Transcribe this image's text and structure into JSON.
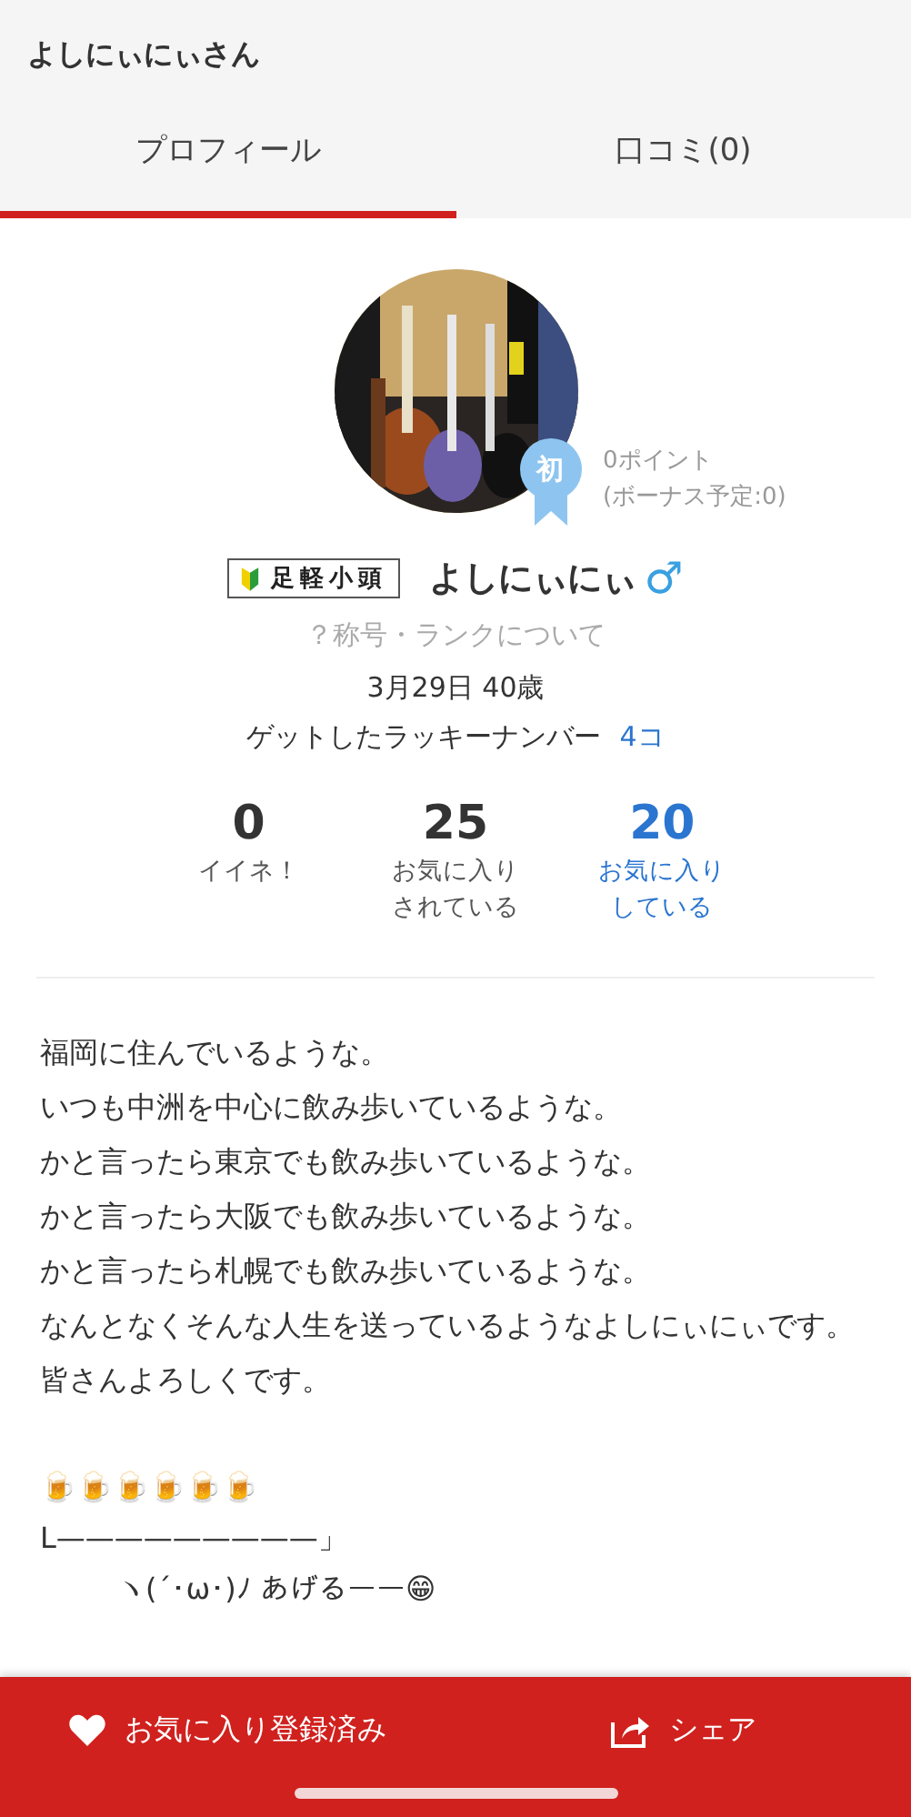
{
  "header": {
    "title": "よしにぃにぃさん"
  },
  "tabs": [
    {
      "label": "プロフィール",
      "selected": true
    },
    {
      "label": "口コミ(0)",
      "selected": false
    }
  ],
  "profile": {
    "badge": "初",
    "points": "0ポイント",
    "bonus": "(ボーナス予定:0)",
    "rank_title": "足軽小頭",
    "name": "よしにぃにぃ",
    "gender": "♂",
    "rank_link": "？称号・ランクについて",
    "birthday": "3月29日 40歳",
    "lucky_label": "ゲットしたラッキーナンバー",
    "lucky_count": "4コ"
  },
  "stats": [
    {
      "value": "0",
      "label": [
        "イイネ！"
      ],
      "kind": "plain"
    },
    {
      "value": "25",
      "label": [
        "お気に入り",
        "されている"
      ],
      "kind": "plain"
    },
    {
      "value": "20",
      "label": [
        "お気に入り",
        "している"
      ],
      "kind": "link"
    }
  ],
  "bio": [
    "福岡に住んでいるような。",
    "いつも中洲を中心に飲み歩いているような。",
    "かと言ったら東京でも飲み歩いているような。",
    "かと言ったら大阪でも飲み歩いているような。",
    "かと言ったら札幌でも飲み歩いているような。",
    "なんとなくそんな人生を送っているようなよしにぃにぃです。",
    "皆さんよろしくです。"
  ],
  "art": [
    {
      "text": "🍺🍺🍺🍺🍺🍺",
      "indent": false
    },
    {
      "text": "L—————————」",
      "indent": false
    },
    {
      "text": "ヽ(´･ω･)ﾉ あげるーー😁",
      "indent": true
    }
  ],
  "footer": {
    "favorite": "お気に入り登録済み",
    "share": "シェア"
  }
}
